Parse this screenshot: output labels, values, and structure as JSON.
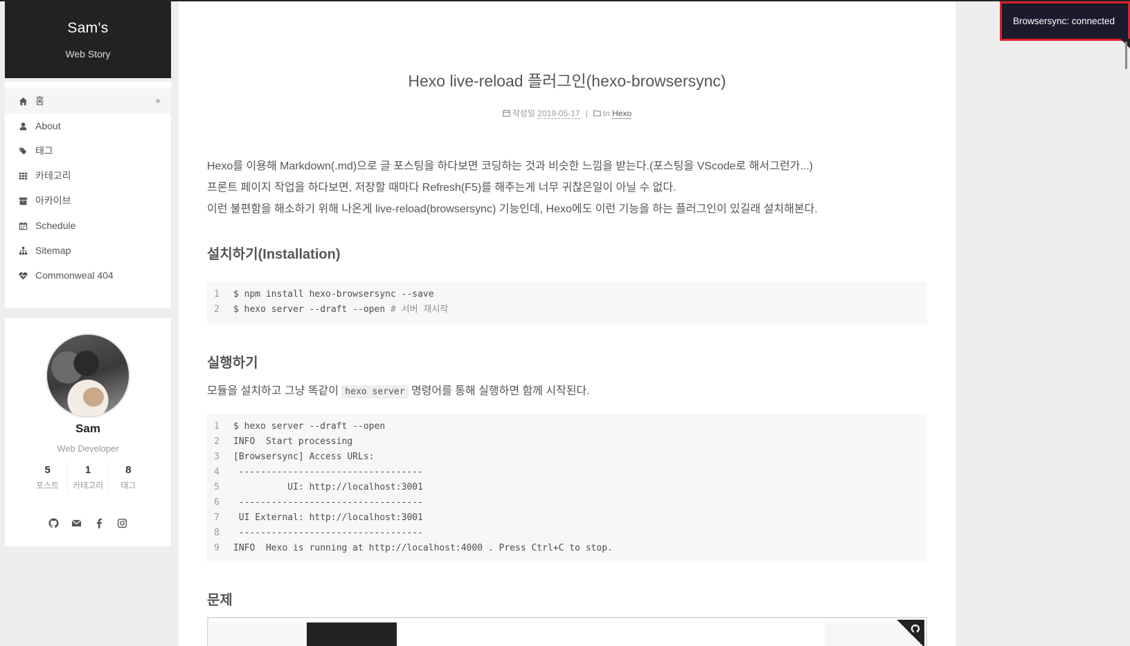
{
  "brand": {
    "title": "Sam's",
    "subtitle": "Web Story"
  },
  "menu": [
    {
      "label": "홈",
      "icon": "home-icon"
    },
    {
      "label": "About",
      "icon": "user-icon"
    },
    {
      "label": "태그",
      "icon": "tags-icon"
    },
    {
      "label": "카테고리",
      "icon": "grid-icon"
    },
    {
      "label": "아카이브",
      "icon": "archive-icon"
    },
    {
      "label": "Schedule",
      "icon": "calendar-icon"
    },
    {
      "label": "Sitemap",
      "icon": "sitemap-icon"
    },
    {
      "label": "Commonweal 404",
      "icon": "heartbeat-icon"
    }
  ],
  "author": {
    "name": "Sam",
    "description": "Web Developer",
    "stats": [
      {
        "count": "5",
        "label": "포스트"
      },
      {
        "count": "1",
        "label": "카테고리"
      },
      {
        "count": "8",
        "label": "태그"
      }
    ],
    "socials": [
      "github-icon",
      "envelope-icon",
      "facebook-icon",
      "instagram-icon"
    ]
  },
  "post": {
    "title": "Hexo live-reload 플러그인(hexo-browsersync)",
    "meta": {
      "posted_label": "작성일",
      "date": "2019-05-17",
      "separator": "|",
      "in_label": "In",
      "category": "Hexo"
    },
    "intro": [
      "Hexo를 이용해 Markdown(.md)으로 글 포스팅을 하다보면 코딩하는 것과 비슷한 느낌을 받는다.(포스팅을 VScode로 해서그런가...)",
      "프론트 페이지 작업을 하다보면, 저장할 때마다 Refresh(F5)를 해주는게 너무 귀찮은일이 아닐 수 없다.",
      "이런 불편함을 해소하기 위해 나온게 live-reload(browsersync) 기능인데, Hexo에도 이런 기능을 하는 플러그인이 있길래 설치해본다."
    ],
    "install_heading": "설치하기(Installation)",
    "install_code": [
      {
        "n": "1",
        "code": "$ npm install hexo-browsersync --save",
        "comment": ""
      },
      {
        "n": "2",
        "code": "$ hexo server --draft --open ",
        "comment": "# 서버 재시작"
      }
    ],
    "run_heading": "실행하기",
    "run_text_before": "모듈을 설치하고 그냥 똑같이 ",
    "run_inline_code": "hexo server",
    "run_text_after": " 명령어를 통해 실행하면 함께 시작된다.",
    "run_code": [
      {
        "n": "1",
        "code": "$ hexo server --draft --open"
      },
      {
        "n": "2",
        "code": "INFO  Start processing"
      },
      {
        "n": "3",
        "code": "[Browsersync] Access URLs:"
      },
      {
        "n": "4",
        "code": " ----------------------------------"
      },
      {
        "n": "5",
        "code": "          UI: http://localhost:3001"
      },
      {
        "n": "6",
        "code": " ----------------------------------"
      },
      {
        "n": "7",
        "code": " UI External: http://localhost:3001"
      },
      {
        "n": "8",
        "code": " ----------------------------------"
      },
      {
        "n": "9",
        "code": "INFO  Hexo is running at http://localhost:4000 . Press Ctrl+C to stop."
      }
    ],
    "problem_heading": "문제"
  },
  "notification": {
    "text": "Browsersync: connected",
    "border_color": "#e0202b"
  }
}
